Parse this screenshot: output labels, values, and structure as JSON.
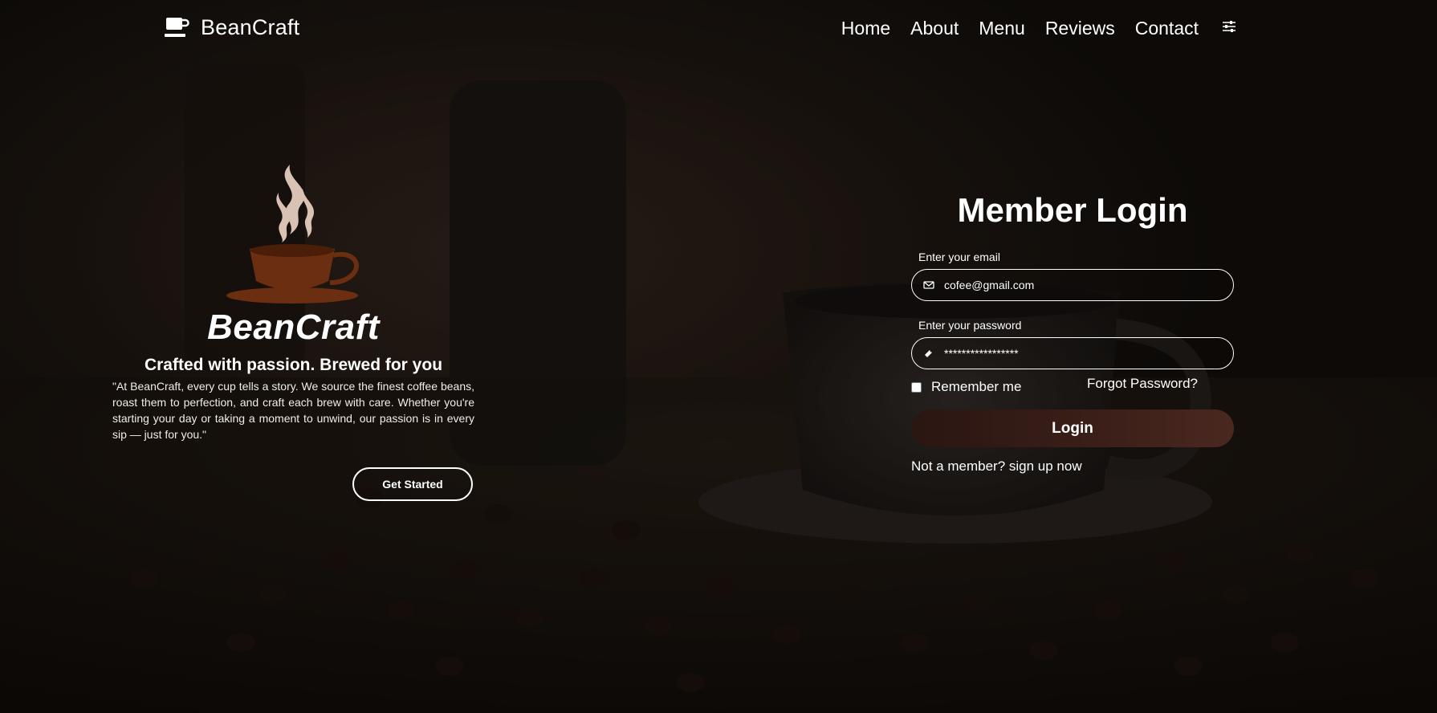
{
  "nav": {
    "brand": "BeanCraft",
    "links": [
      "Home",
      "About",
      "Menu",
      "Reviews",
      "Contact"
    ],
    "settings_icon": "sliders-icon"
  },
  "hero": {
    "title": "BeanCraft",
    "tagline": "Crafted with passion. Brewed for you",
    "description": "\"At BeanCraft, every cup tells a story. We source the finest coffee beans, roast them to perfection, and craft each brew with care. Whether you're starting your day or taking a moment to unwind, our passion is in every sip — just for you.\"",
    "cta": "Get Started"
  },
  "login": {
    "title": "Member Login",
    "email_label": "Enter your email",
    "email_value": "cofee@gmail.com",
    "password_label": "Enter your password",
    "password_value": "*****************",
    "remember_label": "Remember me",
    "forgot_label": "Forgot Password?",
    "submit_label": "Login",
    "signup_text": "Not a member? sign up now"
  },
  "colors": {
    "accent_brown": "#6b2e10",
    "steam": "#d9c2b3",
    "button_bg": "#3a1e18"
  }
}
